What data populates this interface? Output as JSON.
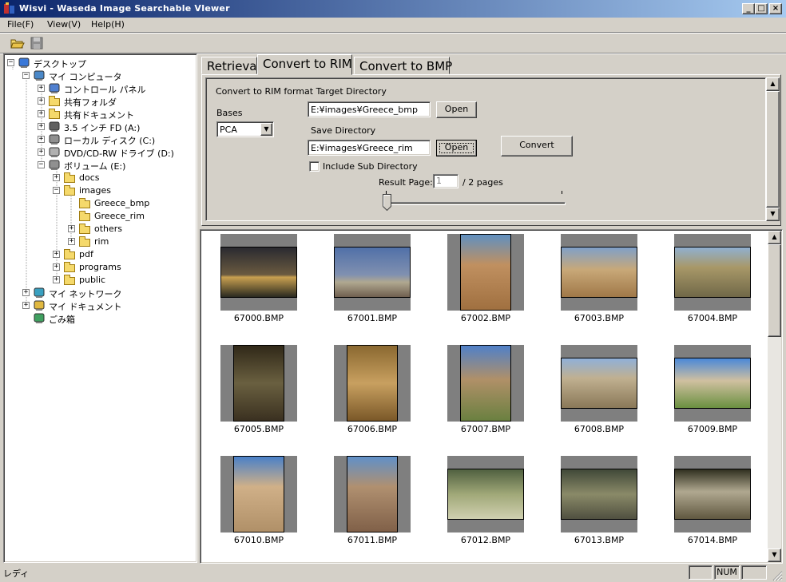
{
  "window": {
    "title": "Wisvi - Waseda Image Searchable VIewer",
    "controls": [
      "_",
      "□",
      "×"
    ]
  },
  "menu": [
    {
      "label": "File(F)"
    },
    {
      "label": "View(V)"
    },
    {
      "label": "Help(H)"
    }
  ],
  "toolbar": {
    "icons": [
      "open-folder-icon",
      "save-icon"
    ]
  },
  "tree": {
    "nodes": [
      {
        "label": "デスクトップ",
        "icon": "desktop-icon",
        "expander": "−"
      },
      {
        "label": "マイ コンピュータ",
        "icon": "computer-icon",
        "expander": "−"
      },
      {
        "label": "コントロール パネル",
        "icon": "control-panel-icon",
        "expander": "+"
      },
      {
        "label": "共有フォルダ",
        "icon": "shared-folder-icon",
        "expander": "+"
      },
      {
        "label": "共有ドキュメント",
        "icon": "folder-icon",
        "expander": "+"
      },
      {
        "label": "3.5 インチ FD (A:)",
        "icon": "floppy-icon",
        "expander": "+"
      },
      {
        "label": "ローカル ディスク (C:)",
        "icon": "disk-icon",
        "expander": "+"
      },
      {
        "label": "DVD/CD-RW ドライブ (D:)",
        "icon": "cd-icon",
        "expander": "+"
      },
      {
        "label": "ボリューム (E:)",
        "icon": "disk-icon",
        "expander": "−"
      },
      {
        "label": "docs",
        "icon": "folder-icon",
        "expander": "+"
      },
      {
        "label": "images",
        "icon": "folder-icon",
        "expander": "−"
      },
      {
        "label": "Greece_bmp",
        "icon": "folder-icon",
        "expander": ""
      },
      {
        "label": "Greece_rim",
        "icon": "folder-icon",
        "expander": ""
      },
      {
        "label": "others",
        "icon": "folder-icon",
        "expander": "+"
      },
      {
        "label": "rim",
        "icon": "folder-icon",
        "expander": "+"
      },
      {
        "label": "pdf",
        "icon": "folder-icon",
        "expander": "+"
      },
      {
        "label": "programs",
        "icon": "folder-icon",
        "expander": "+"
      },
      {
        "label": "public",
        "icon": "folder-icon",
        "expander": "+"
      },
      {
        "label": "マイ ネットワーク",
        "icon": "network-icon",
        "expander": "+"
      },
      {
        "label": "マイ ドキュメント",
        "icon": "documents-icon",
        "expander": "+"
      },
      {
        "label": "ごみ箱",
        "icon": "recycle-bin-icon",
        "expander": ""
      }
    ]
  },
  "tabs": [
    {
      "label": "Retrieval",
      "active": false
    },
    {
      "label": "Convert to RIM",
      "active": true
    },
    {
      "label": "Convert to BMP",
      "active": false
    }
  ],
  "convert": {
    "heading": "Convert to RIM format Target Directory",
    "bases_label": "Bases",
    "bases_value": "PCA",
    "target_dir": "E:¥images¥Greece_bmp",
    "open_label": "Open",
    "save_dir_label": "Save Directory",
    "save_dir": "E:¥images¥Greece_rim",
    "open2_label": "Open",
    "convert_label": "Convert",
    "include_sub": "Include Sub Directory",
    "include_sub_checked": false,
    "result_page_label": "Result Page:",
    "result_page_value": "1",
    "result_pages_total": "/ 2 pages",
    "slider_fraction": 0.0
  },
  "thumbnails": [
    {
      "label": "67000.BMP"
    },
    {
      "label": "67001.BMP"
    },
    {
      "label": "67002.BMP"
    },
    {
      "label": "67003.BMP"
    },
    {
      "label": "67004.BMP"
    },
    {
      "label": "67005.BMP"
    },
    {
      "label": "67006.BMP"
    },
    {
      "label": "67007.BMP"
    },
    {
      "label": "67008.BMP"
    },
    {
      "label": "67009.BMP"
    },
    {
      "label": "67010.BMP"
    },
    {
      "label": "67011.BMP"
    },
    {
      "label": "67012.BMP"
    },
    {
      "label": "67013.BMP"
    },
    {
      "label": "67014.BMP"
    }
  ],
  "status": {
    "text": "レディ",
    "num": "NUM"
  }
}
